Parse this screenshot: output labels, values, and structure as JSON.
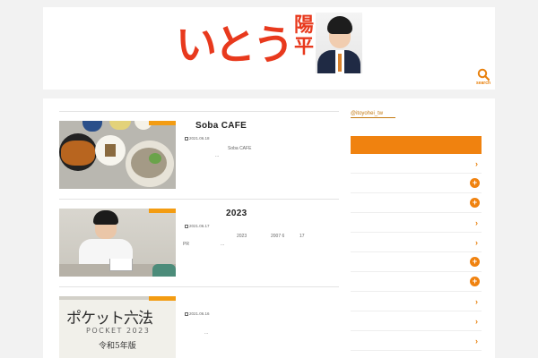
{
  "header": {
    "logo_text": "いとう",
    "logo_kanji": "陽平",
    "search_label": "search"
  },
  "posts": [
    {
      "title": "Soba CAFE",
      "date": "2021.06.18",
      "excerpt_line1": "Soba CAFE",
      "excerpt_line2": "..."
    },
    {
      "title": "2023",
      "date": "2021.06.17",
      "excerpt_a": "2023",
      "excerpt_b": "2007 6",
      "excerpt_c": "17",
      "excerpt_pr": "PR",
      "excerpt_more": "..."
    },
    {
      "title": "",
      "date": "2021.06.16",
      "excerpt_more": "...",
      "book_title": "ポケット六法",
      "book_sub": "POCKET 2023",
      "book_era": "令和5年版"
    }
  ],
  "sidebar": {
    "twitter_link": "@itoyohei_tw",
    "menu_icons": [
      "chevron",
      "plus",
      "plus",
      "chevron",
      "chevron",
      "plus",
      "plus",
      "chevron",
      "chevron",
      "chevron"
    ]
  },
  "colors": {
    "accent": "#f0820f",
    "logo_red": "#e8391d"
  }
}
